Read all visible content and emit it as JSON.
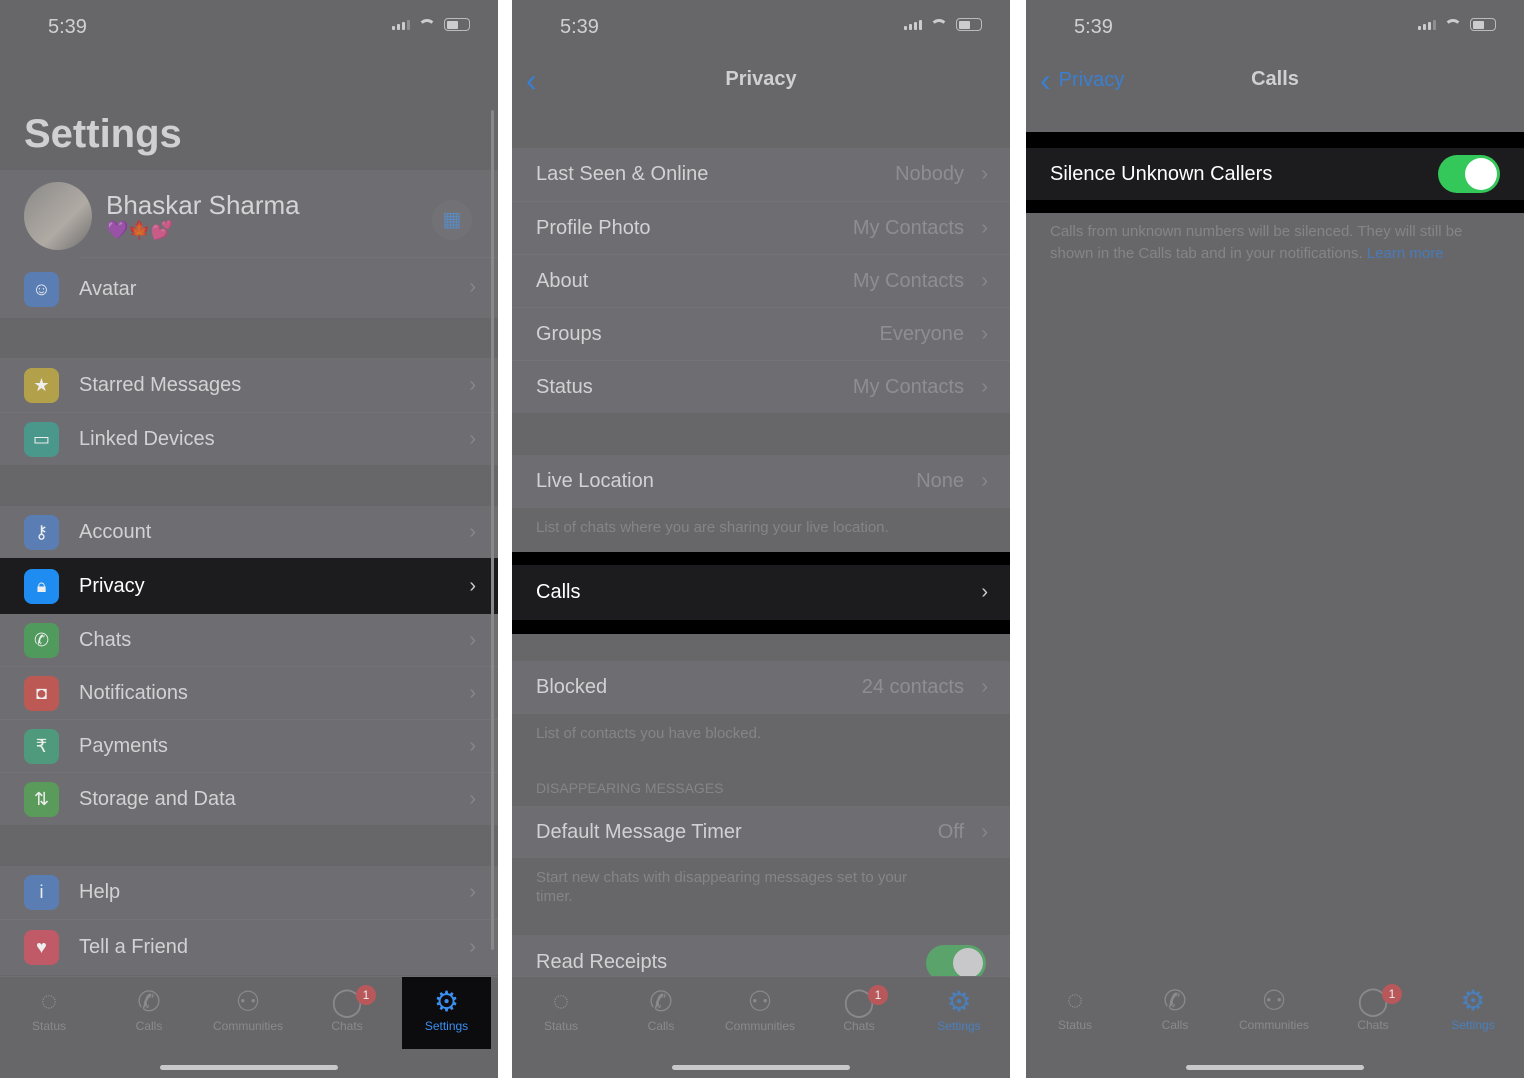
{
  "status_bar": {
    "time": "5:39"
  },
  "settings": {
    "title": "Settings",
    "profile": {
      "name": "Bhaskar Sharma",
      "about": "💜🍁💕",
      "qr_icon": "qr-code-icon"
    },
    "items": [
      {
        "label": "Avatar",
        "icon": "avatar-icon",
        "color": "#5a7db3"
      },
      {
        "label": "Starred Messages",
        "icon": "star-icon",
        "color": "#b3a04a"
      },
      {
        "label": "Linked Devices",
        "icon": "laptop-icon",
        "color": "#4a978b"
      },
      {
        "label": "Account",
        "icon": "key-icon",
        "color": "#5a7db3"
      },
      {
        "label": "Privacy",
        "icon": "lock-icon",
        "color": "#1e8cf0"
      },
      {
        "label": "Chats",
        "icon": "whatsapp-icon",
        "color": "#4f9a5c"
      },
      {
        "label": "Notifications",
        "icon": "notification-icon",
        "color": "#bd5954"
      },
      {
        "label": "Payments",
        "icon": "rupee-icon",
        "color": "#4f9a7c"
      },
      {
        "label": "Storage and Data",
        "icon": "storage-arrows-icon",
        "color": "#5a9a5a"
      },
      {
        "label": "Help",
        "icon": "info-icon",
        "color": "#5a7db3"
      },
      {
        "label": "Tell a Friend",
        "icon": "heart-icon",
        "color": "#c05a66"
      }
    ]
  },
  "privacy": {
    "title": "Privacy",
    "group1": [
      {
        "label": "Last Seen & Online",
        "value": "Nobody"
      },
      {
        "label": "Profile Photo",
        "value": "My Contacts"
      },
      {
        "label": "About",
        "value": "My Contacts"
      },
      {
        "label": "Groups",
        "value": "Everyone"
      },
      {
        "label": "Status",
        "value": "My Contacts"
      }
    ],
    "live_location": {
      "label": "Live Location",
      "value": "None",
      "footer": "List of chats where you are sharing your live location."
    },
    "calls": {
      "label": "Calls"
    },
    "blocked": {
      "label": "Blocked",
      "value": "24 contacts",
      "footer": "List of contacts you have blocked."
    },
    "disappearing_header": "DISAPPEARING MESSAGES",
    "default_timer": {
      "label": "Default Message Timer",
      "value": "Off",
      "footer": "Start new chats with disappearing messages set to your timer."
    },
    "read_receipts": {
      "label": "Read Receipts",
      "enabled": true
    }
  },
  "calls": {
    "back": "Privacy",
    "title": "Calls",
    "silence": {
      "label": "Silence Unknown Callers",
      "enabled": true
    },
    "footer": "Calls from unknown numbers will be silenced. They will still be shown in the Calls tab and in your notifications. ",
    "learn_more": "Learn more"
  },
  "tabs": [
    {
      "label": "Status",
      "icon": "status-icon"
    },
    {
      "label": "Calls",
      "icon": "phone-icon"
    },
    {
      "label": "Communities",
      "icon": "communities-icon"
    },
    {
      "label": "Chats",
      "icon": "chats-icon",
      "badge": "1"
    },
    {
      "label": "Settings",
      "icon": "settings-icon"
    }
  ],
  "colors": {
    "accent": "#1e8cf0",
    "toggle_on": "#34c759",
    "badge": "#b8585a"
  }
}
